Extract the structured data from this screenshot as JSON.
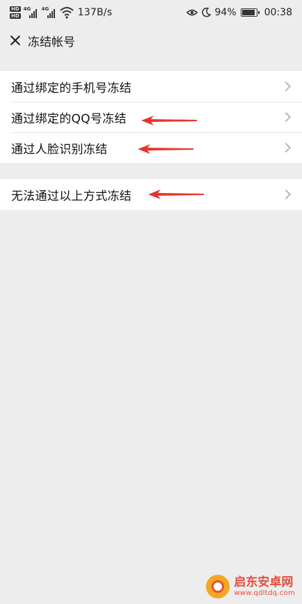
{
  "status_bar": {
    "hd_badges": [
      "HD",
      "HD"
    ],
    "network_1": "4G",
    "network_2": "4G",
    "speed": "137B/s",
    "battery_percent": "94%",
    "battery_level": 0.94,
    "time": "00:38"
  },
  "nav": {
    "title": "冻结帐号"
  },
  "group_1": {
    "items": [
      {
        "label": "通过绑定的手机号冻结"
      },
      {
        "label": "通过绑定的QQ号冻结"
      },
      {
        "label": "通过人脸识别冻结"
      }
    ]
  },
  "group_2": {
    "items": [
      {
        "label": "无法通过以上方式冻结"
      }
    ]
  },
  "watermark": {
    "name": "启东安卓网",
    "url": "www.qdltdq.com"
  },
  "colors": {
    "background": "#ededed",
    "list_background": "#ffffff",
    "arrow": "#e8342c",
    "watermark": "#e84c3d"
  }
}
